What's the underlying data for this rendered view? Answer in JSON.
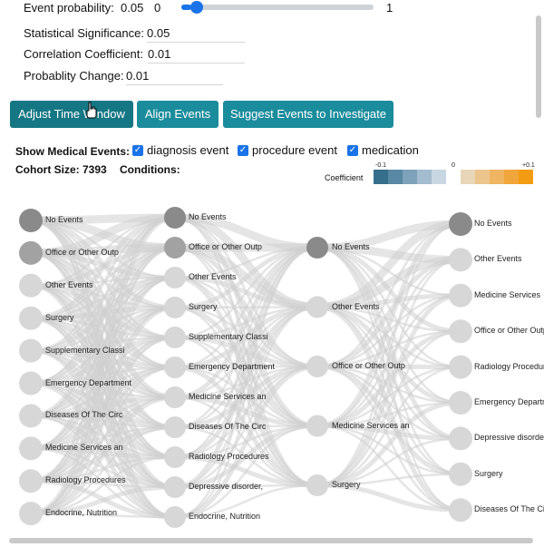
{
  "controls": {
    "event_probability_label": "Event probability:",
    "event_probability_value": "0.05",
    "slider_min": "0",
    "slider_max": "1",
    "slider_value": 0.05,
    "statistical_significance_label": "Statistical Significance:",
    "statistical_significance_value": "0.05",
    "correlation_coefficient_label": "Correlation Coefficient:",
    "correlation_coefficient_value": "0.01",
    "probability_change_label": "Probablity Change:",
    "probability_change_value": "0.01"
  },
  "buttons": {
    "adjust_time_window": "Adjust Time Window",
    "align_events": "Align Events",
    "suggest_events": "Suggest Events to Investigate",
    "accent": "#1b8c9c"
  },
  "filters": {
    "title": "Show Medical Events:",
    "diagnosis": "diagnosis event",
    "procedure": "procedure event",
    "medication": "medication",
    "checked": true
  },
  "cohort": {
    "size_label": "Cohort Size: 7393",
    "conditions_label": "Conditions:"
  },
  "legend": {
    "title": "Coefficient",
    "neg_label": "-0.1",
    "zero_label": "0",
    "pos_label": "+0.1",
    "neg_colors": [
      "#356f8c",
      "#5888a3",
      "#7da2b9",
      "#a3bccf",
      "#c9d7e3"
    ],
    "pos_colors": [
      "#e9d6b8",
      "#ecc58c",
      "#efb562",
      "#f1a63b",
      "#f39c12"
    ]
  },
  "flow": {
    "columns": [
      {
        "nodes": [
          {
            "label": "No Events",
            "color": "#8a8a8a"
          },
          {
            "label": "Office or Other Outp",
            "color": "#a2a2a2"
          },
          {
            "label": "Other Events",
            "color": "#d7d7d7"
          },
          {
            "label": "Surgery",
            "color": "#d7d7d7"
          },
          {
            "label": "Supplementary Classi",
            "color": "#d7d7d7"
          },
          {
            "label": "Emergency Department",
            "color": "#d7d7d7"
          },
          {
            "label": "Diseases Of The Circ",
            "color": "#d7d7d7"
          },
          {
            "label": "Medicine Services an",
            "color": "#d7d7d7"
          },
          {
            "label": "Radiology Procedures",
            "color": "#d7d7d7"
          },
          {
            "label": "Endocrine, Nutrition",
            "color": "#d7d7d7"
          }
        ]
      },
      {
        "nodes": [
          {
            "label": "No Events",
            "color": "#8a8a8a"
          },
          {
            "label": "Office or Other Outp",
            "color": "#a2a2a2"
          },
          {
            "label": "Other Events",
            "color": "#d7d7d7"
          },
          {
            "label": "Surgery",
            "color": "#d7d7d7"
          },
          {
            "label": "Supplementary Classi",
            "color": "#d7d7d7"
          },
          {
            "label": "Emergency Department",
            "color": "#d7d7d7"
          },
          {
            "label": "Medicine Services an",
            "color": "#d7d7d7"
          },
          {
            "label": "Diseases Of The Circ",
            "color": "#d7d7d7"
          },
          {
            "label": "Radiology Procedures",
            "color": "#d7d7d7"
          },
          {
            "label": "Depressive disorder,",
            "color": "#d7d7d7"
          },
          {
            "label": "Endocrine, Nutrition",
            "color": "#d7d7d7"
          }
        ]
      },
      {
        "nodes": [
          {
            "label": "No Events",
            "color": "#8a8a8a"
          },
          {
            "label": "Other Events",
            "color": "#d7d7d7"
          },
          {
            "label": "Office or Other Outp",
            "color": "#d7d7d7"
          },
          {
            "label": "Medicine Services an",
            "color": "#d7d7d7"
          },
          {
            "label": "Surgery",
            "color": "#d7d7d7"
          }
        ]
      },
      {
        "nodes": [
          {
            "label": "No Events",
            "color": "#8a8a8a"
          },
          {
            "label": "Other Events",
            "color": "#d7d7d7"
          },
          {
            "label": "Medicine Services",
            "color": "#d7d7d7"
          },
          {
            "label": "Office or Other Outp",
            "color": "#d7d7d7"
          },
          {
            "label": "Radiology Procedures",
            "color": "#d7d7d7"
          },
          {
            "label": "Emergency Department",
            "color": "#d7d7d7"
          },
          {
            "label": "Depressive disorder",
            "color": "#d7d7d7"
          },
          {
            "label": "Surgery",
            "color": "#d7d7d7"
          },
          {
            "label": "Diseases Of The Circ",
            "color": "#d7d7d7"
          }
        ]
      }
    ]
  }
}
